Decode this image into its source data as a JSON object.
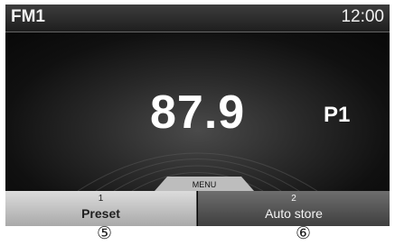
{
  "header": {
    "band": "FM1",
    "clock": "12:00"
  },
  "tuner": {
    "frequency": "87.9",
    "preset": "P1"
  },
  "menu": {
    "label": "MENU"
  },
  "softkeys": [
    {
      "number": "1",
      "label": "Preset"
    },
    {
      "number": "2",
      "label": "Auto store"
    }
  ],
  "callouts": [
    "⑤",
    "⑥"
  ],
  "colors": {
    "screen_bg": "#050505",
    "text": "#ffffff",
    "key_selected": "#d0d0d0",
    "key_normal": "#555555"
  }
}
